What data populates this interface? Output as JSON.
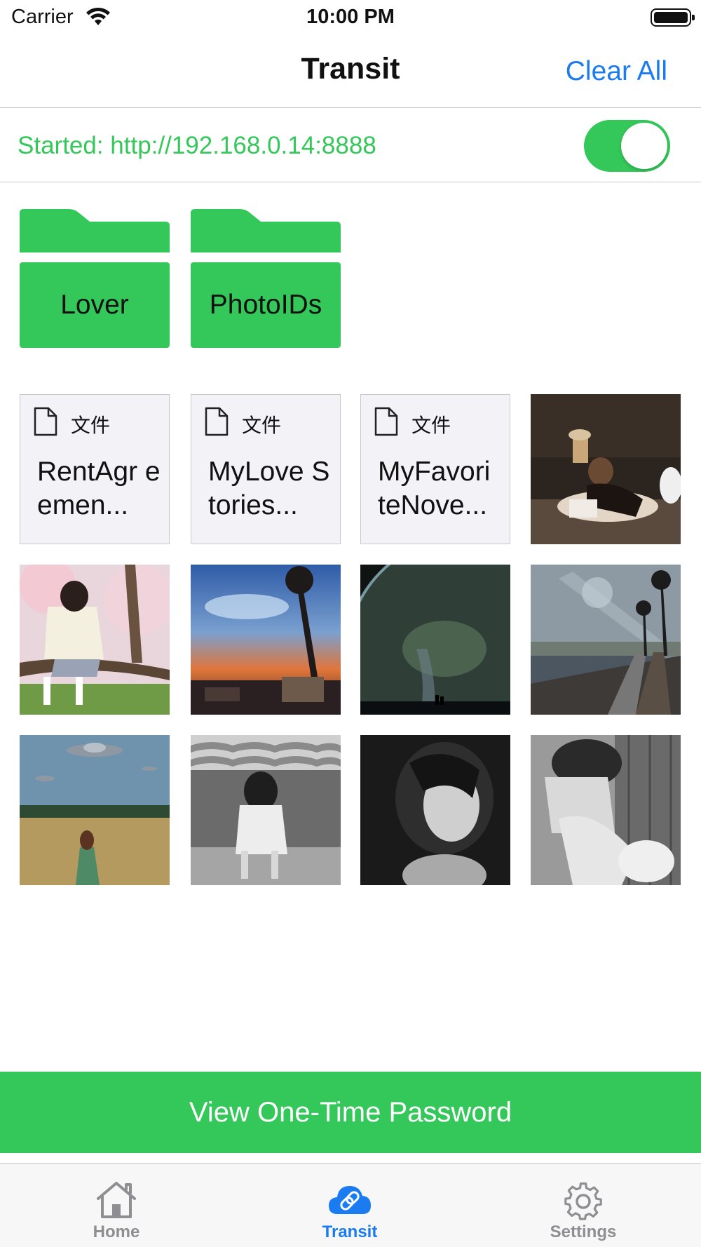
{
  "status_bar": {
    "carrier": "Carrier",
    "time": "10:00 PM"
  },
  "nav": {
    "title": "Transit",
    "clear_all": "Clear All"
  },
  "server": {
    "status_text": "Started: http://192.168.0.14:8888",
    "enabled": true
  },
  "folders": [
    {
      "name": "Lover"
    },
    {
      "name": "PhotoIDs"
    }
  ],
  "documents": [
    {
      "kind": "文件",
      "name": "RentAgr eemen..."
    },
    {
      "kind": "文件",
      "name": "MyLove Stories..."
    },
    {
      "kind": "文件",
      "name": "MyFavori teNove..."
    }
  ],
  "photos_count_shown": 9,
  "otp_button": "View One-Time Password",
  "tab_bar": {
    "items": [
      {
        "label": "Home",
        "icon": "house-icon",
        "active": false
      },
      {
        "label": "Transit",
        "icon": "cloud-link-icon",
        "active": true
      },
      {
        "label": "Settings",
        "icon": "gear-icon",
        "active": false
      }
    ]
  },
  "colors": {
    "accent_green": "#34c759",
    "accent_blue": "#1a7cf0",
    "inactive_gray": "#8e8e93"
  }
}
